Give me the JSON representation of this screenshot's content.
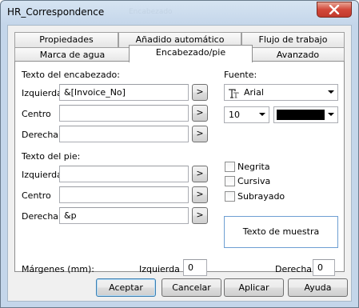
{
  "window": {
    "title": "HR_Correspondence",
    "ghost_title": "Encabezado"
  },
  "tabs": {
    "row_back": [
      "Propiedades",
      "Añadido automático",
      "Flujo de trabajo"
    ],
    "row_front": [
      "Marca de agua",
      "Encabezado/pie",
      "Avanzado"
    ],
    "active": "Encabezado/pie"
  },
  "header": {
    "section_label": "Texto del encabezado:",
    "left_label": "Izquierda",
    "left_value": "&[Invoice_No]",
    "center_label": "Centro",
    "center_value": "",
    "right_label": "Derecha",
    "right_value": ""
  },
  "footer": {
    "section_label": "Texto del pie:",
    "left_label": "Izquierda",
    "left_value": "",
    "center_label": "Centro",
    "center_value": "",
    "right_label": "Derecha",
    "right_value": "&p"
  },
  "insert_button_label": ">",
  "font": {
    "label": "Fuente:",
    "name": "Arial",
    "size": "10",
    "color": "#000000",
    "bold_label": "Negrita",
    "italic_label": "Cursiva",
    "underline_label": "Subrayado",
    "sample_text": "Texto de muestra"
  },
  "margins": {
    "label": "Márgenes (mm):",
    "left_label": "Izquierda",
    "left_value": "0",
    "right_label": "Derecha",
    "right_value": "0"
  },
  "buttons": {
    "ok": "Aceptar",
    "cancel": "Cancelar",
    "apply": "Aplicar",
    "help": "Ayuda"
  }
}
